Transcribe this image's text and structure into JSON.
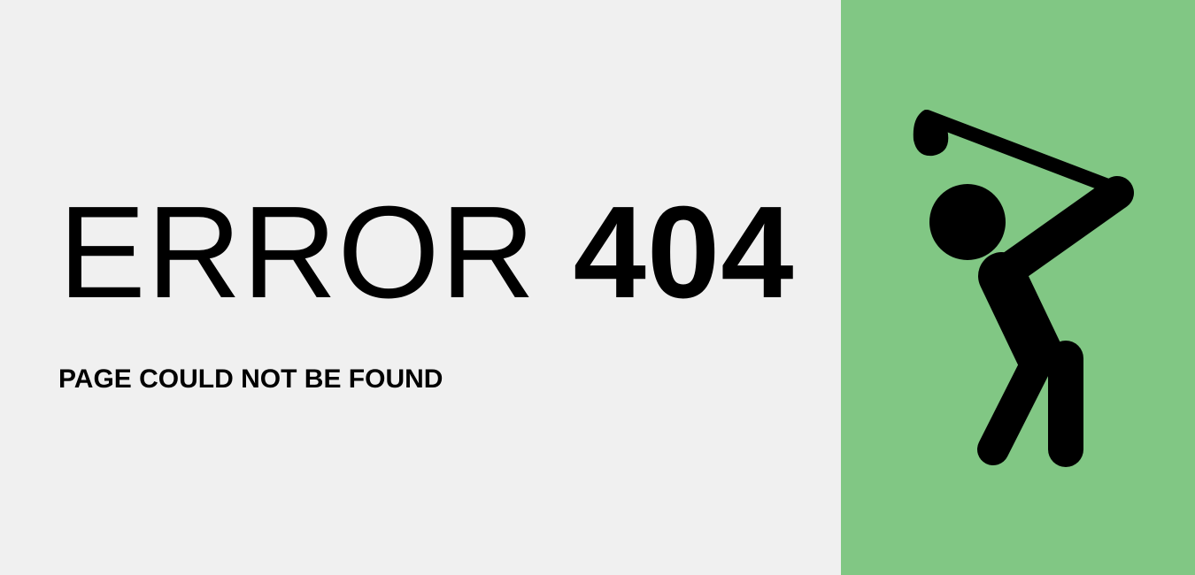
{
  "error": {
    "word": "ERROR",
    "code": "404",
    "message": "PAGE COULD NOT BE FOUND"
  },
  "colors": {
    "background": "#f0f0f0",
    "accent_panel": "#81c784",
    "text": "#000000"
  },
  "illustration": {
    "icon": "golfer-icon"
  }
}
